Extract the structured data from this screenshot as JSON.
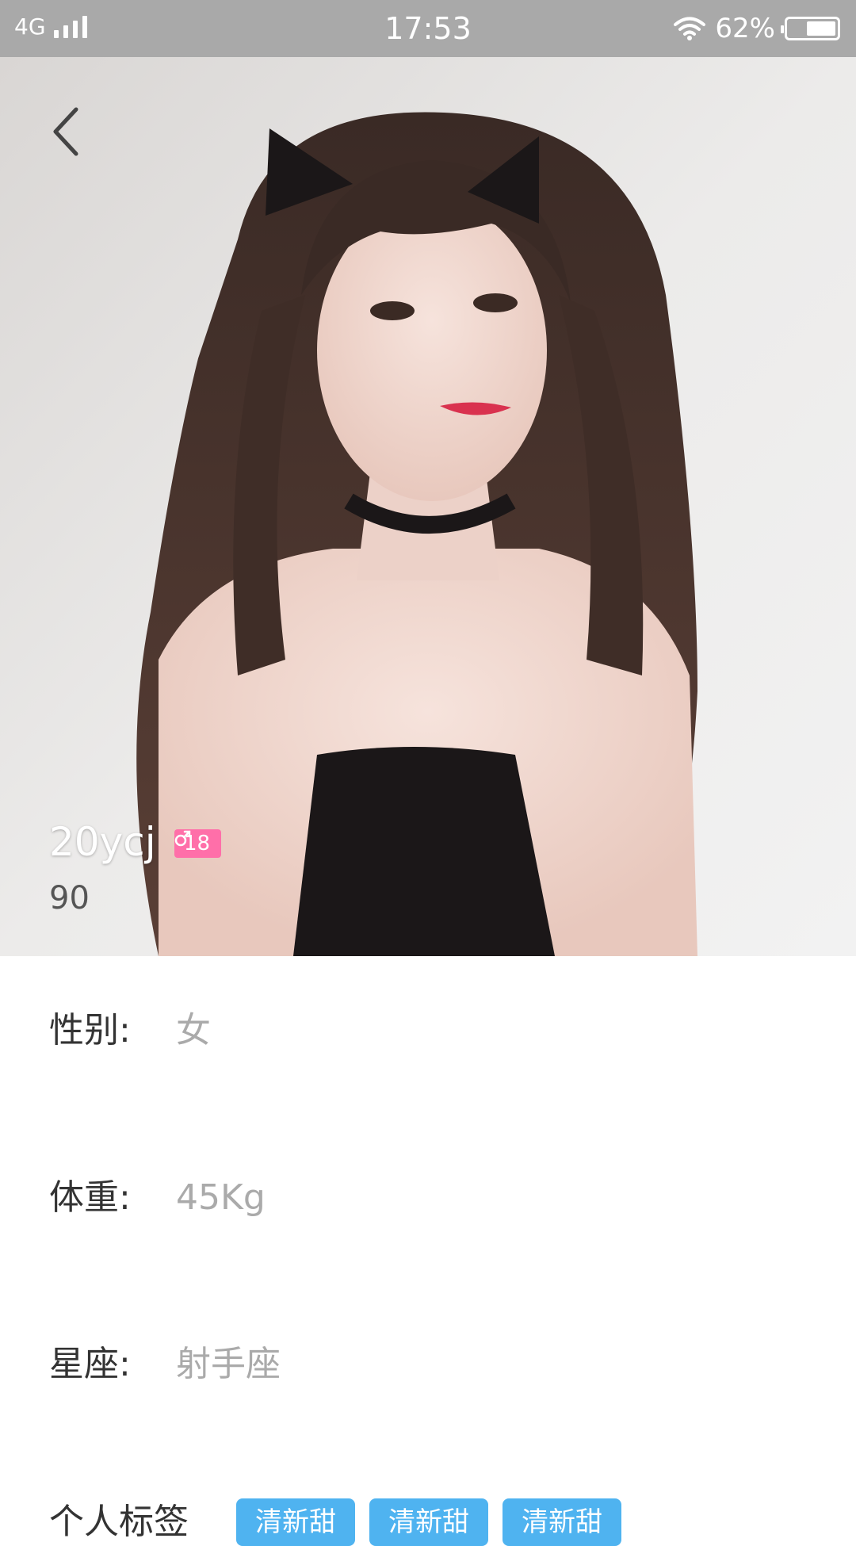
{
  "status_bar": {
    "network": "4G",
    "time": "17:53",
    "battery_percent": "62%",
    "battery_level": 0.62
  },
  "profile": {
    "username": "20ycj",
    "gender_icon": "male-icon",
    "age": "18",
    "sub_value": "90"
  },
  "info": {
    "gender_label": "性别:",
    "gender_value": "女",
    "weight_label": "体重:",
    "weight_value": "45Kg",
    "zodiac_label": "星座:",
    "zodiac_value": "射手座",
    "tags_label": "个人标签",
    "tags": [
      "清新甜",
      "清新甜",
      "清新甜"
    ]
  },
  "colors": {
    "status_bar_bg": "#a9a9a9",
    "badge_pink": "#ff6fa9",
    "tag_blue": "#4fb3f0"
  }
}
